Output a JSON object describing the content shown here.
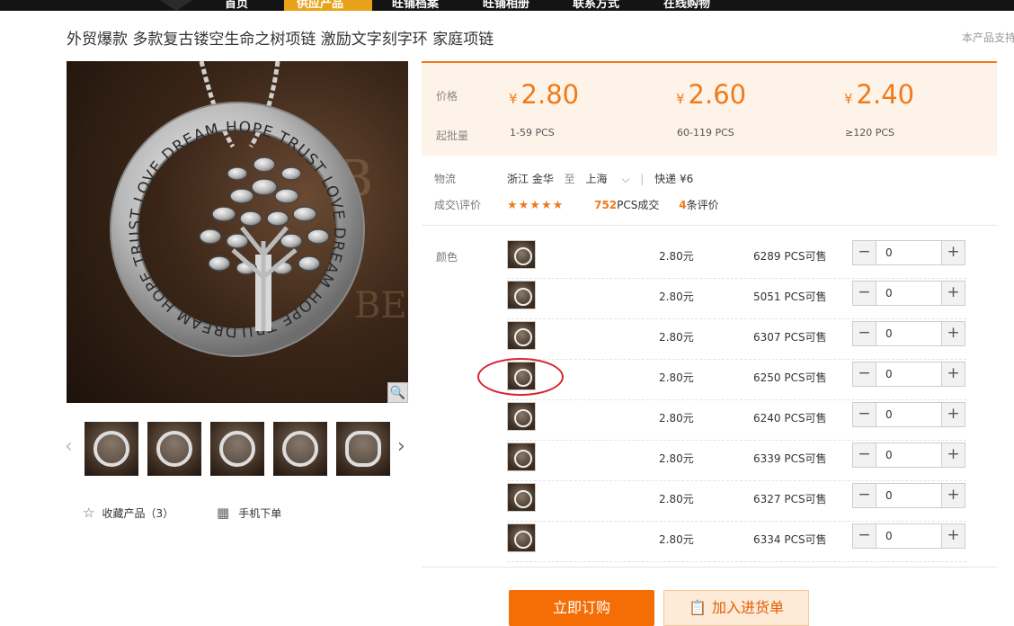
{
  "nav": {
    "items": [
      "首页",
      "供应产品",
      "旺铺档案",
      "旺铺相册",
      "联系方式",
      "在线购物"
    ],
    "active_color": "#e8a21a"
  },
  "product": {
    "title": "外贸爆款 多款复古镂空生命之树项链 激励文字刻字环 家庭项链",
    "support_note": "本产品支持"
  },
  "gallery": {
    "pendant_text": "DREAM HOPE TRUST LOVE DREAM HOPE TRUST LOVE DREAM HOPE TRUST LOVE ",
    "zoom_icon": "magnifier-icon",
    "prev_icon": "chevron-left-icon",
    "next_icon": "chevron-right-icon",
    "thumb_count": 5
  },
  "actions": {
    "favorite_label": "收藏产品（3）",
    "favorite_icon": "star-outline-icon",
    "mobile_order_label": "手机下单",
    "mobile_icon": "qr-code-icon"
  },
  "pricing": {
    "price_label": "价格",
    "moq_label": "起批量",
    "currency": "¥",
    "tiers": [
      {
        "price": "2.80",
        "range": "1-59 PCS"
      },
      {
        "price": "2.60",
        "range": "60-119 PCS"
      },
      {
        "price": "2.40",
        "range": "≥120 PCS"
      }
    ],
    "accent": "#f07a1a"
  },
  "logistics": {
    "label": "物流",
    "from": "浙江 金华",
    "to_word": "至",
    "to": "上海",
    "express": "快递 ¥6"
  },
  "deals": {
    "label": "成交\\评价",
    "stars": "★★★★★",
    "rating": 5,
    "sold_count": "752",
    "sold_suffix": "PCS成交",
    "review_count": "4",
    "review_suffix": "条评价"
  },
  "sku": {
    "label": "颜色",
    "rows": [
      {
        "price": "2.80元",
        "stock": "6289 PCS可售",
        "qty": "0"
      },
      {
        "price": "2.80元",
        "stock": "5051 PCS可售",
        "qty": "0"
      },
      {
        "price": "2.80元",
        "stock": "6307 PCS可售",
        "qty": "0"
      },
      {
        "price": "2.80元",
        "stock": "6250 PCS可售",
        "qty": "0"
      },
      {
        "price": "2.80元",
        "stock": "6240 PCS可售",
        "qty": "0"
      },
      {
        "price": "2.80元",
        "stock": "6339 PCS可售",
        "qty": "0"
      },
      {
        "price": "2.80元",
        "stock": "6327 PCS可售",
        "qty": "0"
      },
      {
        "price": "2.80元",
        "stock": "6334 PCS可售",
        "qty": "0"
      }
    ],
    "minus_symbol": "−",
    "plus_symbol": "+"
  },
  "buttons": {
    "order": "立即订购",
    "cart": "加入进货单",
    "cart_icon": "clipboard-icon"
  }
}
